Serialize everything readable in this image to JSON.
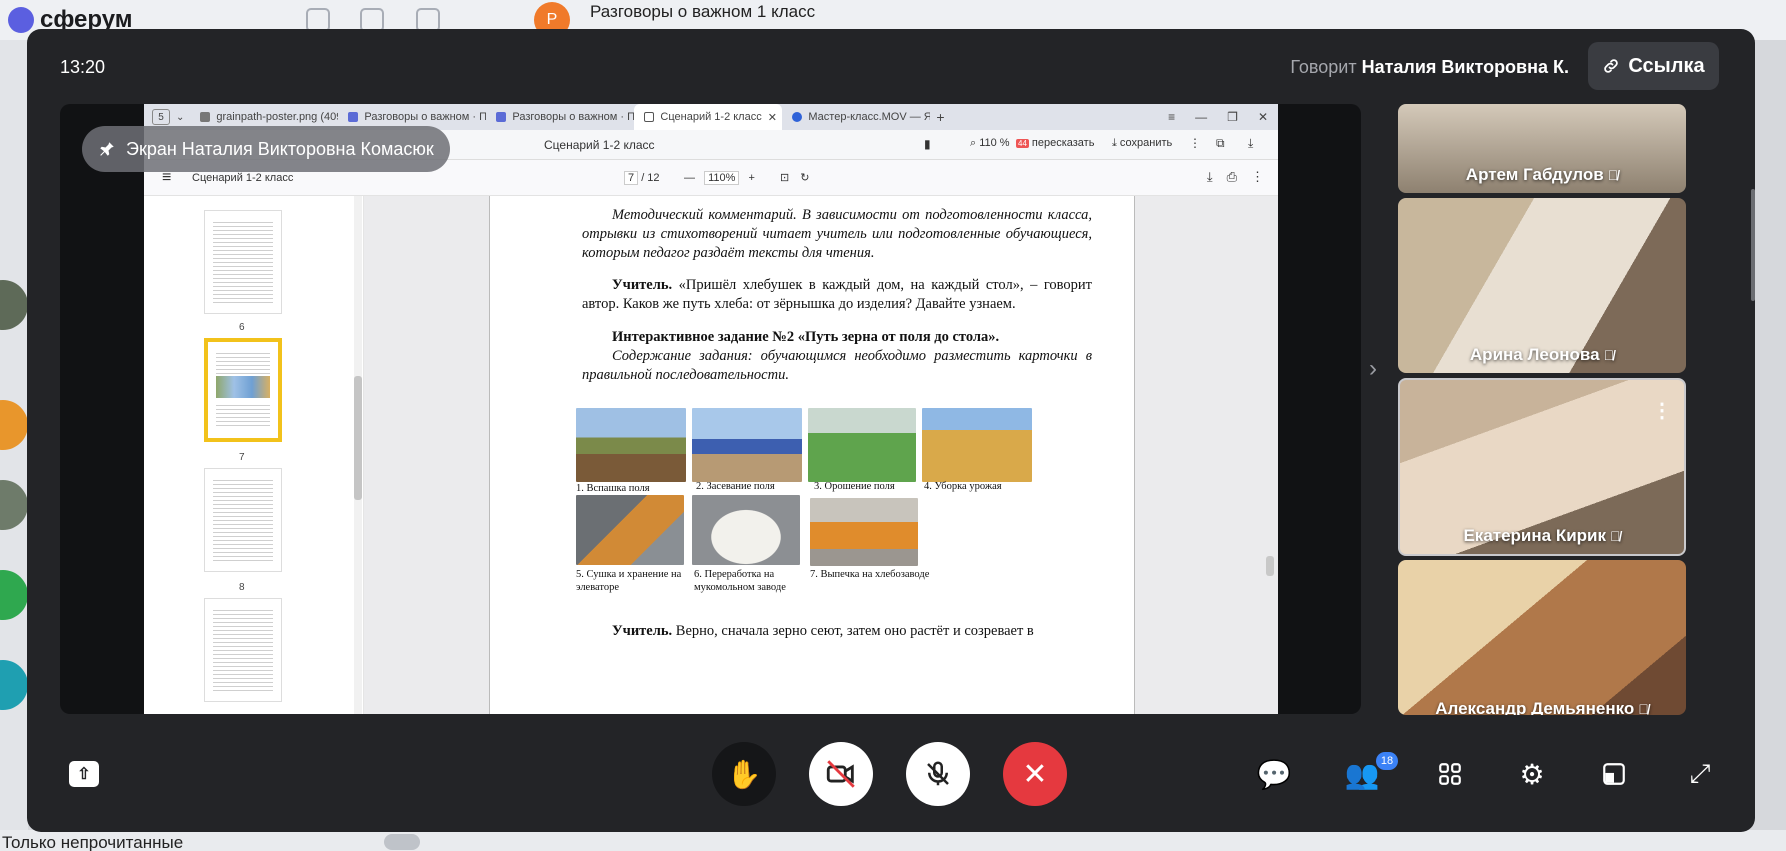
{
  "app": {
    "logo_text": "сферум",
    "chat_title": "Разговоры о важном 1 класс",
    "chat_avatar_letter": "Р",
    "filter_label": "Только непрочитанные"
  },
  "call": {
    "time": "13:20",
    "speaker_prefix": "Говорит",
    "speaker_name": "Наталия Викторовна К.",
    "link_button": "Ссылка",
    "screen_share_label": "Экран Наталия Викторовна Комасюк",
    "participants_count": "18"
  },
  "browser": {
    "tab_count": "5",
    "tabs": [
      {
        "label": "grainpath-poster.png (409"
      },
      {
        "label": "Разговоры о важном · Пу"
      },
      {
        "label": "Разговоры о важном · Пу"
      },
      {
        "label": "Сценарий 1-2 класс"
      },
      {
        "label": "Мастер-класс.MOV — Янд"
      }
    ],
    "address_title": "Сценарий 1-2 класс",
    "zoom": "110 %",
    "retell_badge": "44",
    "retell": "пересказать",
    "save": "сохранить"
  },
  "pdf": {
    "name": "Сценарий 1-2 класс",
    "page_current": "7",
    "page_total": "/ 12",
    "zoom": "110%",
    "thumb_numbers": [
      "6",
      "7",
      "8"
    ],
    "content": {
      "comment": "Методический комментарий. В зависимости от подготовленности класса, отрывки из стихотворений читает учитель или подготовленные обучающиеся, которым педагог раздаёт тексты для чтения.",
      "teacher_label": "Учитель.",
      "teacher_text": "«Пришёл хлебушек в каждый дом, на каждый стол», – говорит автор. Каков же путь хлеба: от зёрнышка до изделия? Давайте узнаем.",
      "task_title": "Интерактивное задание №2 «Путь зерна от поля до стола».",
      "task_text": "Содержание задания: обучающимся необходимо разместить карточки в правильной последовательности.",
      "captions": [
        "1. Вспашка поля",
        "2. Засевание поля",
        "3. Орошение поля",
        "4. Уборка урожая",
        "5. Сушка и хранение на элеваторе",
        "6. Переработка на мукомольном заводе",
        "7. Выпечка на хлебозаводе"
      ],
      "teacher2_label": "Учитель.",
      "teacher2_text": "Верно, сначала зерно сеют, затем оно растёт и созревает в"
    }
  },
  "participants": [
    {
      "name": "Артем Габдулов"
    },
    {
      "name": "Арина Леонова"
    },
    {
      "name": "Екатерина Кирик"
    },
    {
      "name": "Александр Демьяненко"
    }
  ],
  "colors": {
    "modal_bg": "#232427",
    "end_call": "#e5393f",
    "badge": "#3b82f6",
    "selected_thumb": "#f2c21b"
  }
}
